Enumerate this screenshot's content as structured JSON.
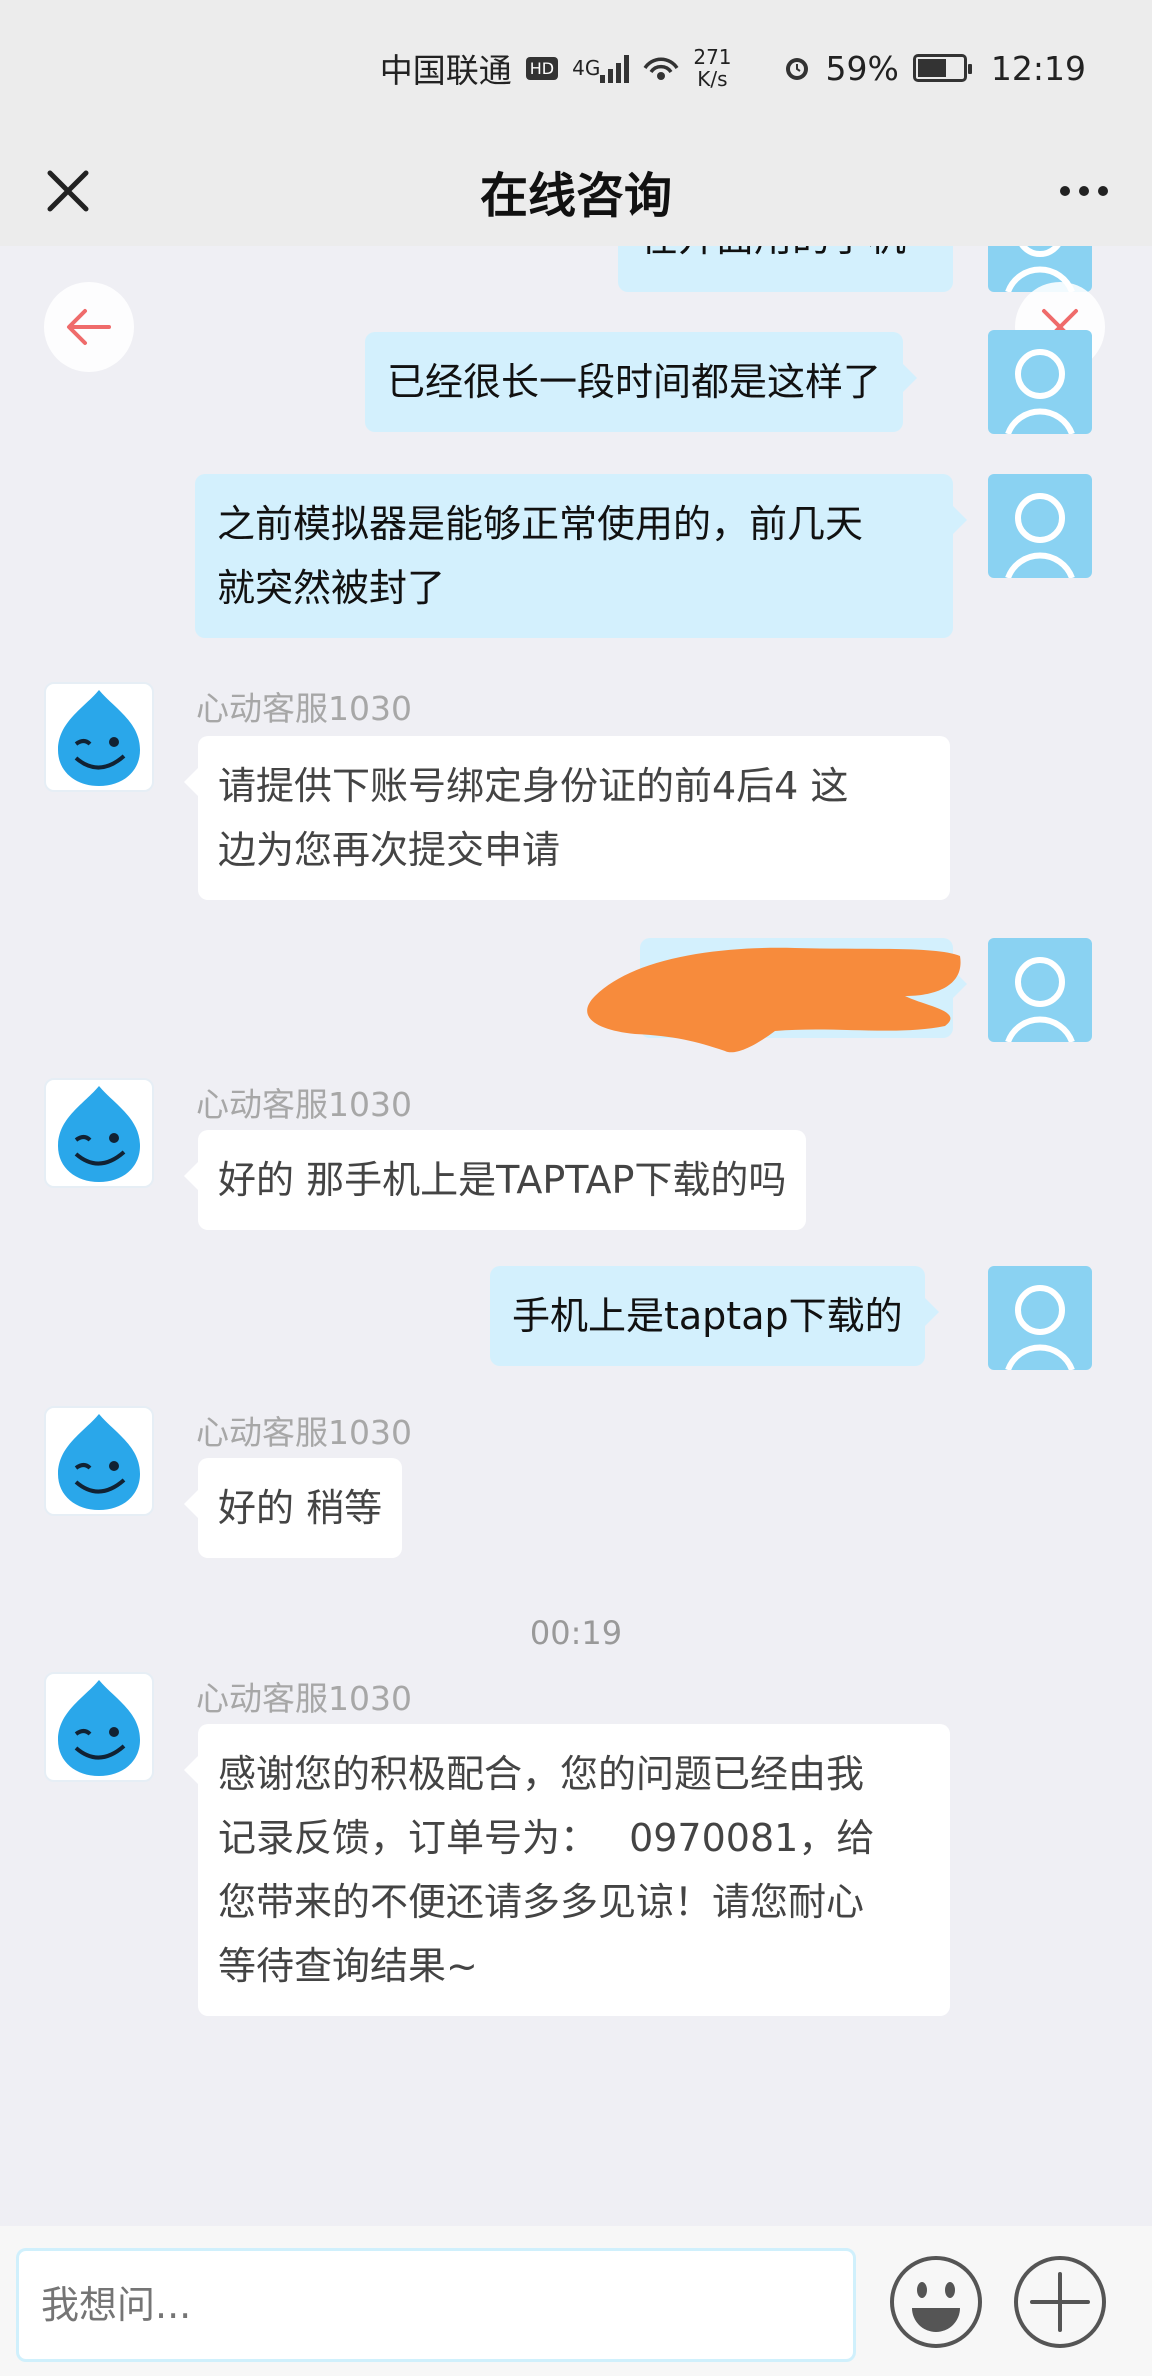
{
  "status_bar": {
    "carrier": "中国联通",
    "hd": "HD",
    "net_type": "4G",
    "speed_value": "271",
    "speed_unit": "K/s",
    "battery": "59%",
    "time": "12:19"
  },
  "header": {
    "title": "在线咨询"
  },
  "messages": {
    "user_partial": "在开面用的手机",
    "user_1": "已经很长一段时间都是这样了",
    "user_2_line1": "之前模拟器是能够正常使用的，前几天",
    "user_2_line2": "就突然被封了",
    "agent_1_name": "心动客服1030",
    "agent_1_line1": "请提供下账号绑定身份证的前4后4 这",
    "agent_1_line2": "边为您再次提交申请",
    "agent_2_name": "心动客服1030",
    "agent_2_text": "好的 那手机上是TAPTAP下载的吗",
    "user_4": "手机上是taptap下载的",
    "agent_3_name": "心动客服1030",
    "agent_3_text": "好的 稍等",
    "time_divider": "00:19",
    "agent_4_name": "心动客服1030",
    "agent_4_line1": "感谢您的积极配合，您的问题已经由我",
    "agent_4_line2": "记录反馈，订单号为：　 0970081，给",
    "agent_4_line3": "您带来的不便还请多多见谅！请您耐心",
    "agent_4_line4": "等待查询结果~"
  },
  "composer": {
    "placeholder": "我想问..."
  },
  "icons": {
    "close": "close-icon",
    "more": "more-icon",
    "back": "back-arrow-icon",
    "dismiss": "dismiss-icon",
    "emoji": "emoji-icon",
    "add": "plus-icon"
  },
  "colors": {
    "user_bubble": "#d3f0fd",
    "agent_bubble": "#ffffff",
    "background": "#efeff4",
    "user_avatar": "#8ad2f2",
    "redaction": "#f78b3c"
  }
}
